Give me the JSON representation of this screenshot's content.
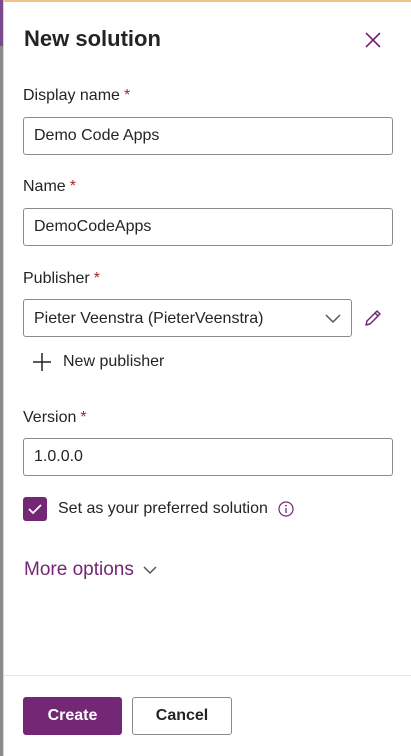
{
  "colors": {
    "accent": "#742774",
    "required": "#a4262c",
    "border": "#8a8a8a"
  },
  "dialog": {
    "title": "New solution",
    "close_icon": "close-icon"
  },
  "form": {
    "display_name": {
      "label": "Display name",
      "required_mark": "*",
      "value": "Demo Code Apps"
    },
    "name": {
      "label": "Name",
      "required_mark": "*",
      "value": "DemoCodeApps"
    },
    "publisher": {
      "label": "Publisher",
      "required_mark": "*",
      "selected": "Pieter Veenstra (PieterVeenstra)",
      "edit_icon": "pencil-icon",
      "new_publisher_label": "New publisher",
      "new_publisher_icon": "plus-icon"
    },
    "version": {
      "label": "Version",
      "required_mark": "*",
      "value": "1.0.0.0"
    },
    "preferred": {
      "label": "Set as your preferred solution",
      "checked": true,
      "info_icon": "info-icon"
    },
    "more_options": {
      "label": "More options",
      "icon": "chevron-down-icon"
    }
  },
  "footer": {
    "create_label": "Create",
    "cancel_label": "Cancel"
  }
}
